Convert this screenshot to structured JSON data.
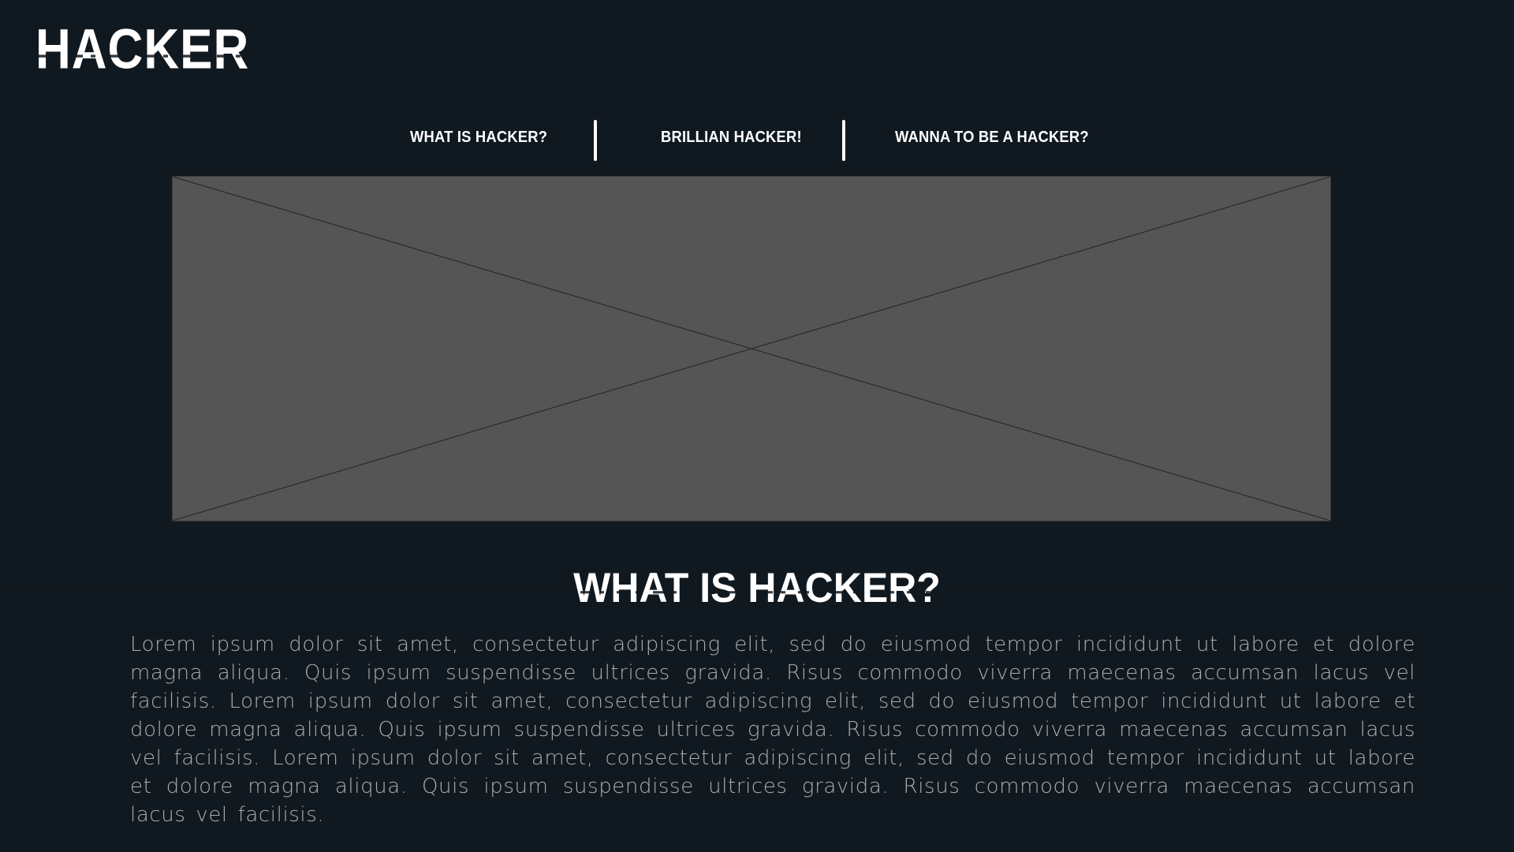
{
  "brand": {
    "logo_text": "HACKER"
  },
  "nav": {
    "items": [
      {
        "label": "WHAT IS HACKER?"
      },
      {
        "label": "BRILLIAN HACKER!"
      },
      {
        "label": "WANNA TO BE A HACKER?"
      }
    ]
  },
  "hero": {
    "image_fill": "#555555"
  },
  "section": {
    "title": "WHAT IS HACKER?",
    "body": "Lorem ipsum dolor sit amet, consectetur adipiscing elit, sed do eiusmod tempor incididunt ut labore et dolore magna aliqua. Quis ipsum suspendisse ultrices gravida. Risus commodo viverra maecenas accumsan lacus vel facilisis. Lorem ipsum dolor sit amet, consectetur adipiscing elit, sed do eiusmod tempor incididunt ut labore et dolore magna aliqua. Quis ipsum suspendisse ultrices gravida. Risus commodo viverra maecenas accumsan lacus vel facilisis. Lorem ipsum dolor sit amet, consectetur adipiscing elit, sed do eiusmod tempor incididunt ut labore et dolore magna aliqua. Quis ipsum suspendisse ultrices gravida. Risus commodo viverra maecenas accumsan lacus vel facilisis."
  },
  "colors": {
    "background": "#111920",
    "text": "#ffffff",
    "body_text": "#a8adb2",
    "placeholder": "#555555"
  }
}
